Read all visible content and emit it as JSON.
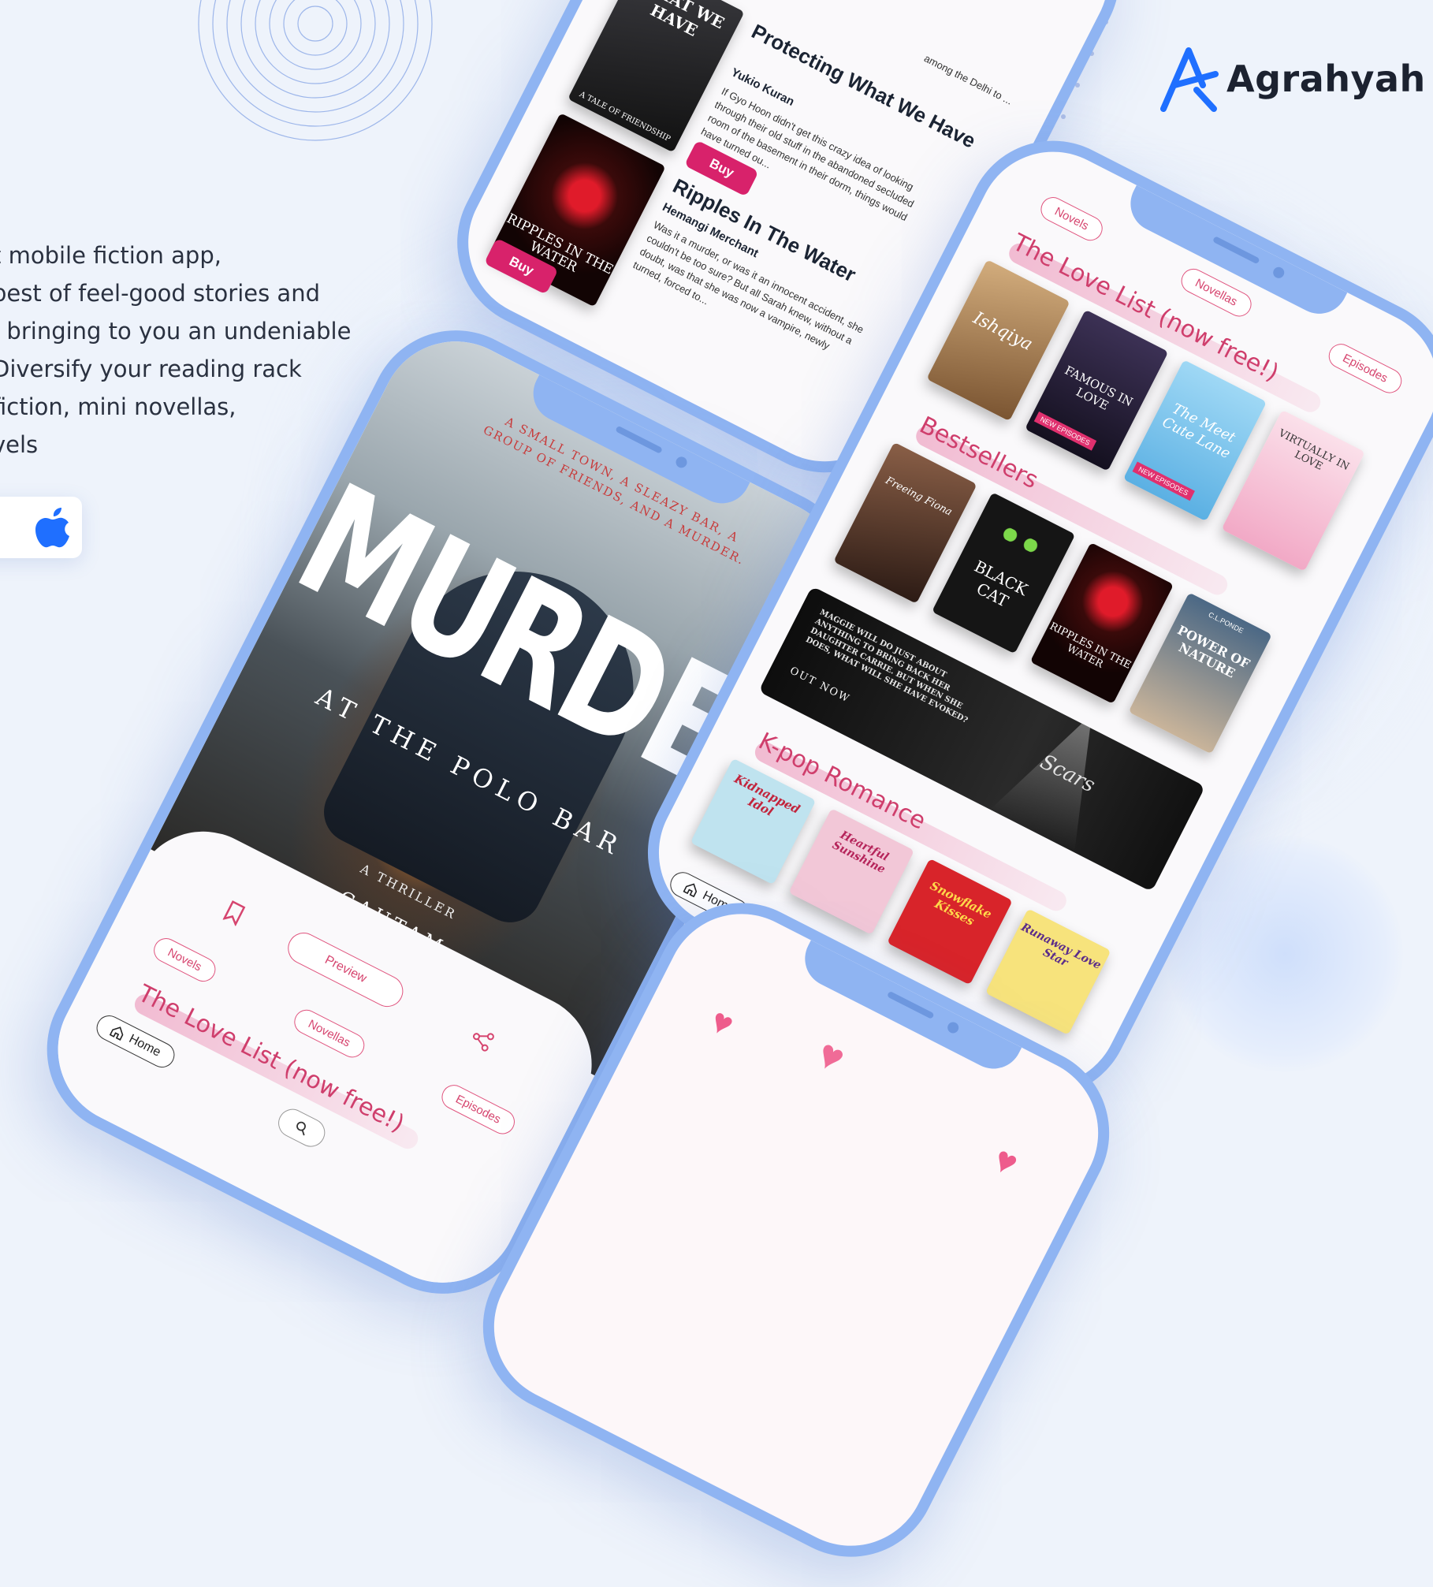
{
  "brand": {
    "name": "Agrahyah",
    "accent": "#1f6fff"
  },
  "intro": {
    "lines": [
      "t mobile fiction app,",
      "best of feel-good stories and",
      ", bringing to you an undeniable",
      "Diversify your reading rack",
      "fiction, mini novellas,",
      "vels"
    ]
  },
  "store": {
    "icon": "apple-icon"
  },
  "top_phone": {
    "books": [
      {
        "cover_text": "WHAT WE HAVE",
        "cover_sub": "A TALE OF FRIENDSHIP",
        "title": "Protecting What We Have",
        "author": "Yukio Kuran",
        "blurb": "If Gyo Hoon didn't get this crazy idea of looking through their old stuff in the abandoned secluded room of the basement in their dorm, things would have turned ou...",
        "buy": "Buy"
      },
      {
        "cover_text": "RIPPLES IN THE WATER",
        "title": "Ripples In The Water",
        "author": "Hemangi Merchant",
        "blurb": "Was it a murder, or was it an innocent accident, she couldn't be too sure? But all Sarah knew, without a doubt, was that she was now a vampire, newly turned, forced to...",
        "buy": "Buy"
      }
    ],
    "corner_text": "among the Delhi to ..."
  },
  "left_phone": {
    "cover": {
      "tagline": "A SMALL TOWN, A SLEAZY BAR, A GROUP OF FRIENDS, AND A MURDER.",
      "title": "MURDER",
      "subtitle": "AT THE POLO BAR",
      "genre": "A THRILLER",
      "author": "GAUTAM"
    },
    "preview": "Preview",
    "tabs": [
      "Novels",
      "Novellas",
      "Episodes"
    ],
    "section": "The Love List (now free!)",
    "home": "Home"
  },
  "right_phone": {
    "tabs": [
      "Novels",
      "Novellas",
      "Episodes"
    ],
    "sections": {
      "love": "The Love List (now free!)",
      "best": "Bestsellers",
      "kpop": "K-pop Romance"
    },
    "love_books": [
      {
        "title": "Ishqiya",
        "bg": "#b88a5a"
      },
      {
        "title": "FAMOUS IN LOVE",
        "badge": "NEW EPISODES",
        "bg": "#2b2340"
      },
      {
        "title": "The Meet Cute Lane",
        "badge": "NEW EPISODES",
        "bg": "#7cc4ef"
      },
      {
        "title": "VIRTUALLY IN LOVE",
        "bg": "#f7c9dc"
      }
    ],
    "best_books": [
      {
        "title": "Freeing Fiona",
        "bg": "#5a3b2e"
      },
      {
        "title": "BLACK CAT",
        "bg": "#151515"
      },
      {
        "title": "RIPPLES IN THE WATER",
        "bg": "#1e0d0d"
      },
      {
        "title": "POWER OF NATURE",
        "author": "C.L.PONDE",
        "bg": "#6c87a4"
      }
    ],
    "banner": {
      "text": "MAGGIE WILL DO JUST ABOUT ANYTHING TO BRING BACK HER DAUGHTER CARRIE. BUT WHEN SHE DOES, WHAT WILL SHE HAVE EVOKED?",
      "cta": "OUT NOW",
      "title": "Scars"
    },
    "kpop_books": [
      {
        "title": "Kidnapped Idol",
        "bg": "#bfe3ef"
      },
      {
        "title": "Heartful Sunshine",
        "bg": "#f2c7d7"
      },
      {
        "title": "Snowflake Kisses",
        "bg": "#d8242a"
      },
      {
        "title": "Runaway Love Star",
        "bg": "#f7e37c"
      }
    ],
    "home": "Home"
  }
}
